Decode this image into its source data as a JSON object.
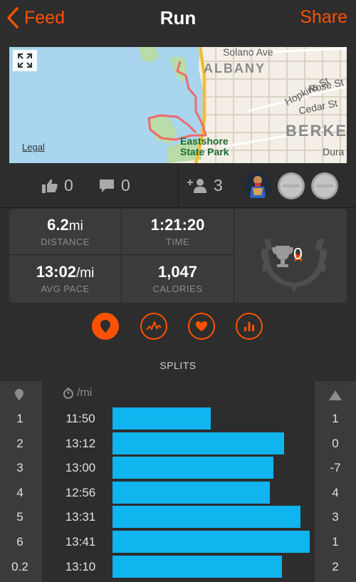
{
  "nav": {
    "back_label": "Feed",
    "title": "Run",
    "share_label": "Share"
  },
  "map": {
    "legal": "Legal",
    "labels": {
      "albany": "ALBANY",
      "berkeley": "BERKE",
      "park_line1": "Eastshore",
      "park_line2": "State Park"
    },
    "streets": [
      "Solano Ave",
      "Hopkins St",
      "Rose St",
      "Cedar St",
      "Dura"
    ]
  },
  "social": {
    "kudos_count": "0",
    "comment_count": "0",
    "athlete_count": "3"
  },
  "stats": {
    "distance_value": "6.2",
    "distance_unit": "mi",
    "distance_label": "DISTANCE",
    "time_value": "1:21:20",
    "time_label": "TIME",
    "pace_value": "13:02",
    "pace_unit": "/mi",
    "pace_label": "AVG PACE",
    "calories_value": "1,047",
    "calories_label": "CALORIES",
    "achievements_count": "0"
  },
  "tabs": [
    {
      "icon": "map-pin-icon",
      "active": true
    },
    {
      "icon": "pace-chart-icon",
      "active": false
    },
    {
      "icon": "heart-icon",
      "active": false
    },
    {
      "icon": "bar-chart-icon",
      "active": false
    }
  ],
  "splits": {
    "title": "SPLITS",
    "pace_header": "/mi",
    "rows": [
      {
        "num": "1",
        "pace": "11:50",
        "pace_seconds": 710,
        "elev": "1"
      },
      {
        "num": "2",
        "pace": "13:12",
        "pace_seconds": 792,
        "elev": "0"
      },
      {
        "num": "3",
        "pace": "13:00",
        "pace_seconds": 780,
        "elev": "-7"
      },
      {
        "num": "4",
        "pace": "12:56",
        "pace_seconds": 776,
        "elev": "4"
      },
      {
        "num": "5",
        "pace": "13:31",
        "pace_seconds": 811,
        "elev": "3"
      },
      {
        "num": "6",
        "pace": "13:41",
        "pace_seconds": 821,
        "elev": "1"
      },
      {
        "num": "0.2",
        "pace": "13:10",
        "pace_seconds": 790,
        "elev": "2"
      }
    ]
  },
  "colors": {
    "accent": "#fc5200",
    "bar": "#10b4ee",
    "background": "#2d2d2d",
    "panel": "#3b3b3b"
  }
}
